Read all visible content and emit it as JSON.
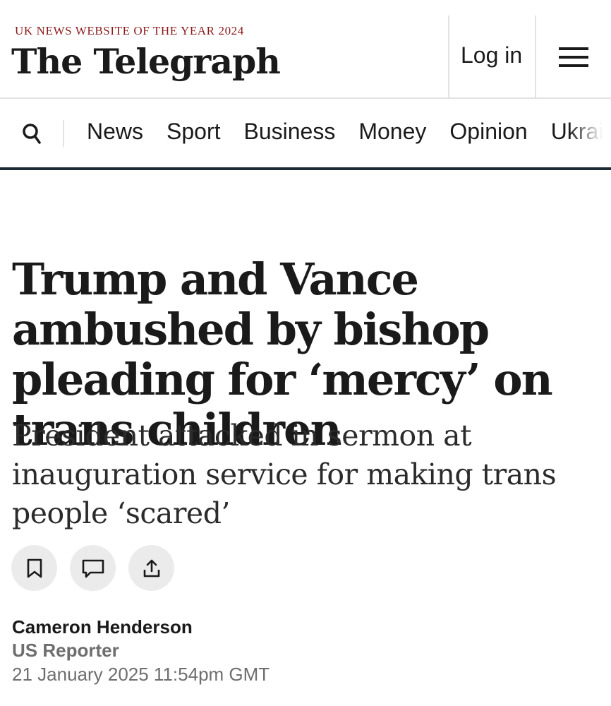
{
  "header": {
    "tagline": "UK NEWS WEBSITE OF THE YEAR 2024",
    "brand": "The Telegraph",
    "login_label": "Log in",
    "menu_icon": "hamburger-menu-icon"
  },
  "nav": {
    "search_icon": "search-icon",
    "items": [
      "News",
      "Sport",
      "Business",
      "Money",
      "Opinion",
      "Ukraine"
    ]
  },
  "article": {
    "headline": "Trump and Vance ambushed by bishop pleading for ‘mercy’ on trans children",
    "standfirst": "President attacked in sermon at inauguration service for making trans people ‘scared’",
    "actions": [
      {
        "icon": "bookmark-icon"
      },
      {
        "icon": "comment-icon"
      },
      {
        "icon": "share-icon"
      }
    ],
    "author": "Cameron Henderson",
    "role": "US Reporter",
    "date": "21 January 2025 11:54pm GMT"
  },
  "colors": {
    "tagline": "#8b1a1a",
    "nav_border": "#1c2a36",
    "button_bg": "#ebebeb",
    "meta_gray": "#6e6e6e"
  }
}
